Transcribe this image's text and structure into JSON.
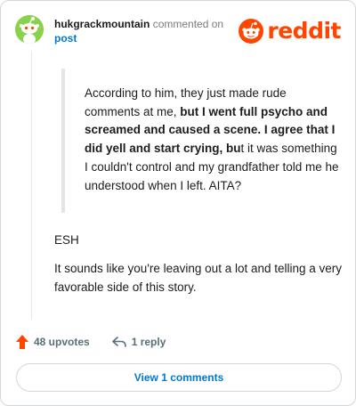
{
  "header": {
    "username": "hukgrackmountain",
    "action_text": " commented on",
    "post_link": "post",
    "logo_text": "reddit",
    "avatar_icon": "snoo-avatar-icon",
    "logo_icon": "snoo-icon"
  },
  "quote": {
    "part1": "According to him, they just made rude comments at me, ",
    "bold": "but I went full psycho and screamed and caused a scene. I agree that I did yell and start crying, bu",
    "part2": "t it was something I couldn't control and my grandfather told me he understood when I left. AITA?"
  },
  "comment": {
    "verdict": "ESH",
    "body": "It sounds like you're leaving out a lot and telling a very favorable side of this story."
  },
  "actions": {
    "upvotes": "48 upvotes",
    "replies": "1 reply",
    "upvote_icon": "upvote-arrow-icon",
    "reply_icon": "reply-arrow-icon"
  },
  "footer": {
    "view_button": "View 1 comments"
  },
  "colors": {
    "brand": "#ff4500",
    "link": "#0079d3",
    "avatar_bg": "#8ad24d"
  }
}
